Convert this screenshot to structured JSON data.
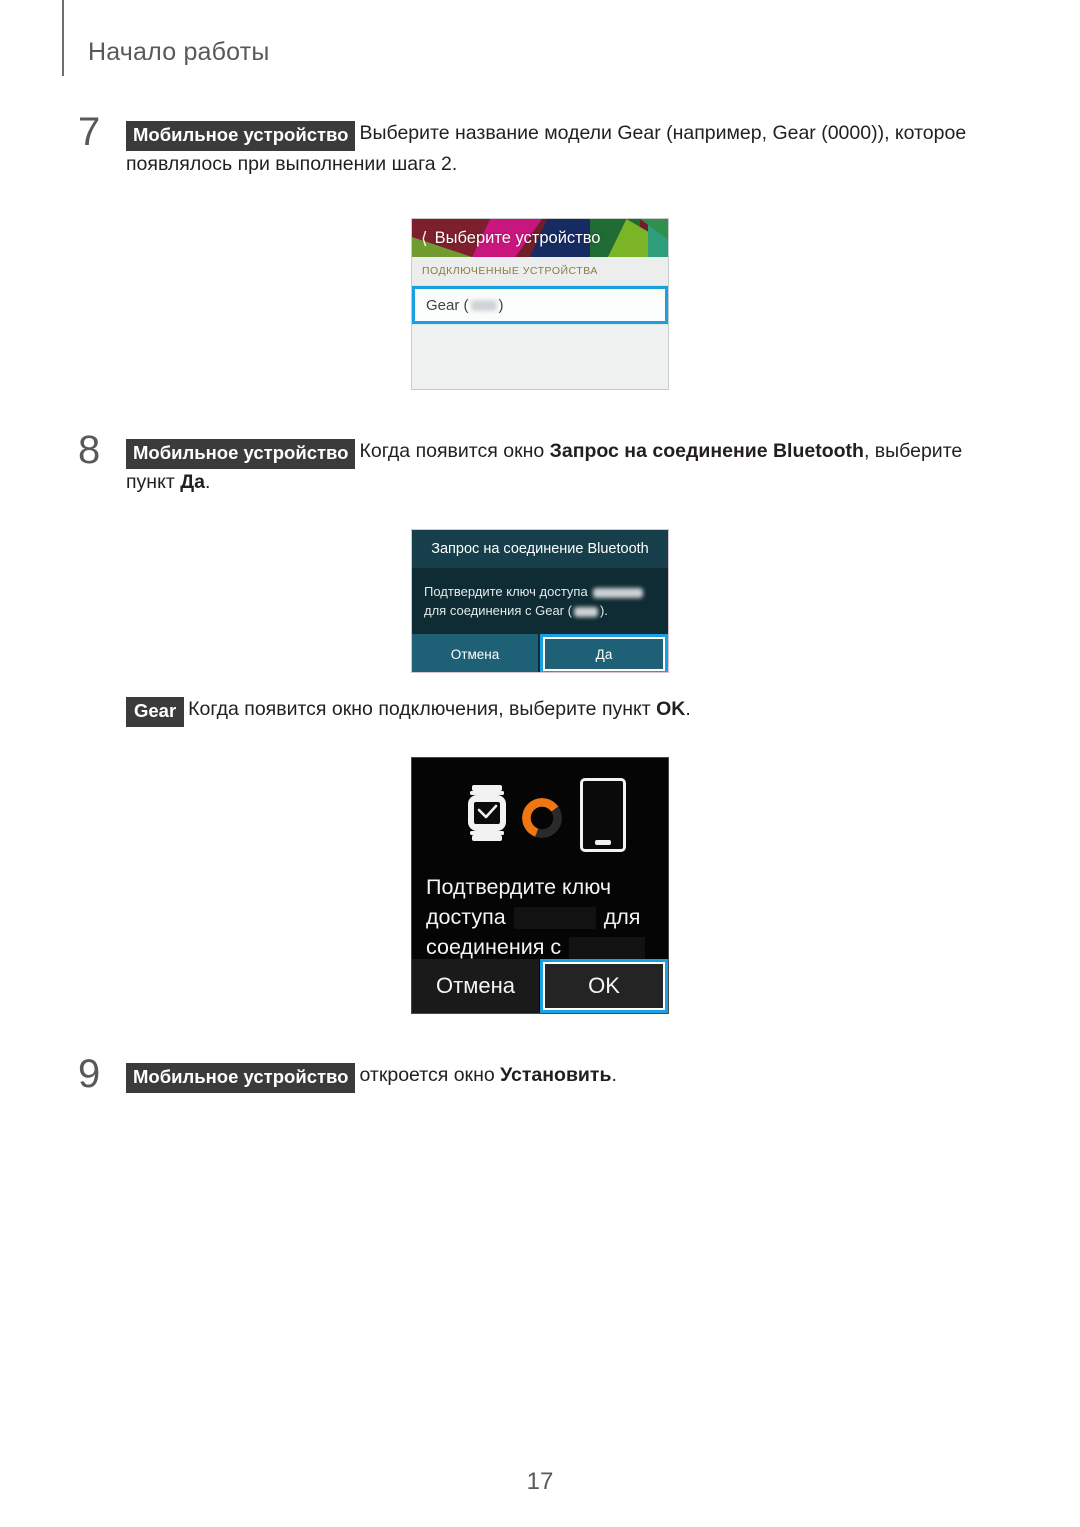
{
  "page": {
    "header_title": "Начало работы",
    "page_number": "17"
  },
  "steps": [
    {
      "number": "7",
      "badge": "Мобильное устройство",
      "text_1": "Выберите название модели Gear (например, Gear (0000)), которое появлялось при выполнении шага 2."
    },
    {
      "number": "8",
      "badge": "Мобильное устройство",
      "text_1": "Когда появится окно ",
      "bold_1": "Запрос на соединение Bluetooth",
      "text_2": ", выберите пункт ",
      "bold_2": "Да",
      "text_3": "."
    },
    {
      "badge": "Gear",
      "text_1": "Когда появится окно подключения, выберите пункт ",
      "bold_1": "OK",
      "text_2": "."
    },
    {
      "number": "9",
      "badge": "Мобильное устройство",
      "text_1": "откроется окно ",
      "bold_1": "Установить",
      "text_2": "."
    }
  ],
  "device_picker": {
    "back_icon": "chevron-left-icon",
    "title": "Выберите устройство",
    "section_label": "ПОДКЛЮЧЕННЫЕ УСТРОЙСТВА",
    "device_name_prefix": "Gear (",
    "device_name_suffix": ")",
    "highlight_color": "#1a9fe0"
  },
  "bluetooth_dialog": {
    "title": "Запрос на соединение Bluetooth",
    "body_line_1_prefix": "Подтвердите ключ доступа",
    "body_line_2_prefix": "для соединения с Gear (",
    "body_line_2_suffix": ").",
    "cancel_label": "Отмена",
    "confirm_label": "Да",
    "highlight_color": "#1a9fe0"
  },
  "gear_screen": {
    "watch_icon": "watch-check-icon",
    "spinner_icon": "loading-spinner-icon",
    "phone_icon": "phone-icon",
    "text_line_1": "Подтвердите ключ",
    "text_line_2_prefix": "доступа",
    "text_line_2_suffix": "для",
    "text_line_3_prefix": "соединения с",
    "cancel_label": "Отмена",
    "confirm_label": "OK",
    "highlight_color": "#1a9fe0",
    "spinner_color": "#ef7613"
  }
}
